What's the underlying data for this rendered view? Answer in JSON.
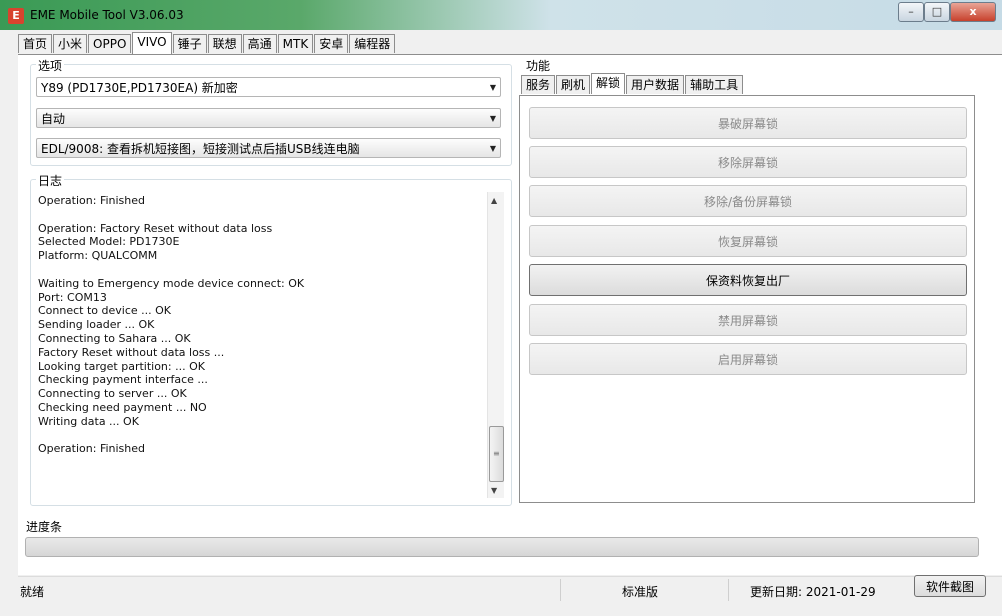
{
  "window": {
    "title": "EME Mobile Tool V3.06.03",
    "controls": {
      "minimize": "–",
      "maximize": "□",
      "close": "x"
    }
  },
  "main_tabs": [
    {
      "label": "首页",
      "active": false
    },
    {
      "label": "小米",
      "active": false
    },
    {
      "label": "OPPO",
      "active": false
    },
    {
      "label": "VIVO",
      "active": true
    },
    {
      "label": "锤子",
      "active": false
    },
    {
      "label": "联想",
      "active": false
    },
    {
      "label": "高通",
      "active": false
    },
    {
      "label": "MTK",
      "active": false
    },
    {
      "label": "安卓",
      "active": false
    },
    {
      "label": "编程器",
      "active": false
    }
  ],
  "options": {
    "label": "选项",
    "model": "Y89 (PD1730E,PD1730EA) 新加密",
    "mode": "自动",
    "method": "EDL/9008: 查看拆机短接图，短接测试点后插USB线连电脑"
  },
  "log": {
    "label": "日志",
    "text": "Operation: Finished\n\nOperation: Factory Reset without data loss\nSelected Model: PD1730E\nPlatform: QUALCOMM\n\nWaiting to Emergency mode device connect: OK\nPort: COM13\nConnect to device ... OK\nSending loader ... OK\nConnecting to Sahara ... OK\nFactory Reset without data loss ...\nLooking target partition: ... OK\nChecking payment interface ...\nConnecting to server ... OK\nChecking need payment ... NO\nWriting data ... OK\n\nOperation: Finished"
  },
  "function": {
    "label": "功能",
    "tabs": [
      {
        "label": "服务",
        "active": false
      },
      {
        "label": "刷机",
        "active": false
      },
      {
        "label": "解锁",
        "active": true
      },
      {
        "label": "用户数据",
        "active": false
      },
      {
        "label": "辅助工具",
        "active": false
      }
    ],
    "buttons": [
      {
        "label": "暴破屏幕锁",
        "enabled": false
      },
      {
        "label": "移除屏幕锁",
        "enabled": false
      },
      {
        "label": "移除/备份屏幕锁",
        "enabled": false
      },
      {
        "label": "恢复屏幕锁",
        "enabled": false
      },
      {
        "label": "保资料恢复出厂",
        "enabled": true
      },
      {
        "label": "禁用屏幕锁",
        "enabled": false
      },
      {
        "label": "启用屏幕锁",
        "enabled": false
      }
    ]
  },
  "progress": {
    "label": "进度条",
    "value": 0
  },
  "status": {
    "state": "就绪",
    "edition": "标准版",
    "update_date": "更新日期:  2021-01-29",
    "screenshot_button": "软件截图"
  }
}
